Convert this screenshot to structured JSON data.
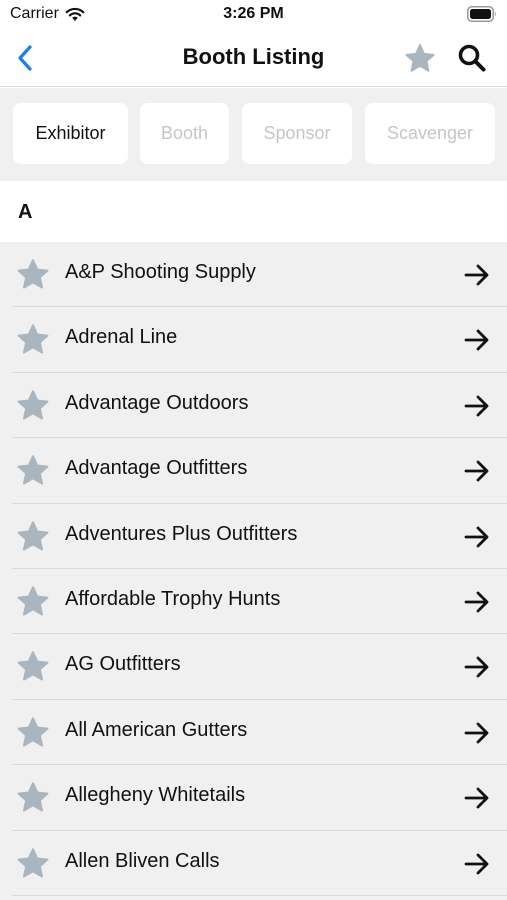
{
  "status_bar": {
    "carrier": "Carrier",
    "time": "3:26 PM"
  },
  "nav": {
    "title": "Booth Listing",
    "back_icon": "chevron-left-icon",
    "favorites_icon": "star-icon",
    "search_icon": "search-icon",
    "accent_color": "#1a7df0"
  },
  "filters": [
    {
      "label": "Exhibitor",
      "active": true
    },
    {
      "label": "Booth",
      "active": false
    },
    {
      "label": "Sponsor",
      "active": false
    },
    {
      "label": "Scavenger",
      "active": false
    }
  ],
  "section": {
    "letter": "A"
  },
  "booths": [
    {
      "name": "A&P Shooting Supply"
    },
    {
      "name": "Adrenal Line"
    },
    {
      "name": "Advantage Outdoors"
    },
    {
      "name": "Advantage Outfitters"
    },
    {
      "name": "Adventures Plus Outfitters"
    },
    {
      "name": "Affordable Trophy Hunts"
    },
    {
      "name": "AG Outfitters"
    },
    {
      "name": "All American Gutters"
    },
    {
      "name": "Allegheny Whitetails"
    },
    {
      "name": "Allen Bliven Calls"
    }
  ],
  "colors": {
    "star_inactive": "#a9b6bf",
    "list_background": "#f0f0f0"
  }
}
